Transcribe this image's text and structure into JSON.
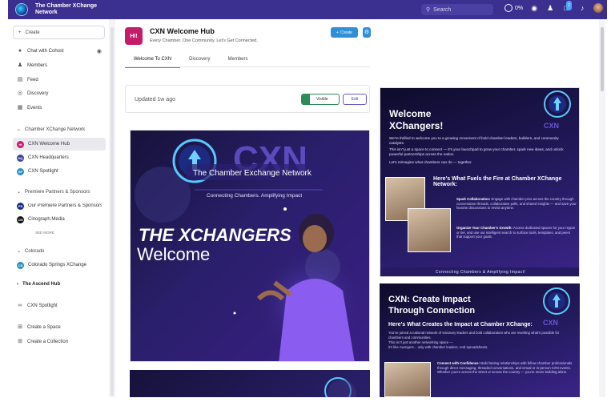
{
  "brand": {
    "line1": "The Chamber XChange",
    "line2": "Network"
  },
  "topbar": {
    "search_placeholder": "Search",
    "progress": "0%",
    "notif_badge": "2"
  },
  "sidebar": {
    "create_label": "Create",
    "items": [
      {
        "label": "Chat with Cohost",
        "icon": "chat-icon"
      },
      {
        "label": "Members",
        "icon": "members-icon"
      },
      {
        "label": "Feed",
        "icon": "feed-icon"
      },
      {
        "label": "Discovery",
        "icon": "compass-icon"
      },
      {
        "label": "Events",
        "icon": "calendar-icon"
      }
    ],
    "group1": "Chamber XChange Network",
    "group1_items": [
      {
        "label": "CXN Welcome Hub",
        "avatar": "HI",
        "color": "#c41b6b"
      },
      {
        "label": "CXN Headquarters",
        "avatar": "HQ",
        "color": "#3b3fa0"
      },
      {
        "label": "CXN Spotlight",
        "avatar": "SP",
        "color": "#2a90c0"
      }
    ],
    "group2": "Premiere Partners & Sponsors",
    "group2_items": [
      {
        "label": "Our Premiere Partners & Sponsors",
        "avatar": "PS",
        "color": "#1a2c8a"
      },
      {
        "label": "Cinograph.Media",
        "avatar": "CM",
        "color": "#111111"
      }
    ],
    "see_more": "SEE MORE",
    "group3": "Colorado",
    "group3_items": [
      {
        "label": "Colorado Springs XChange",
        "avatar": "CS",
        "color": "#2a90c0"
      }
    ],
    "group4": "The Ascend Hub",
    "footer_items": [
      {
        "label": "CXN Spotlight",
        "icon": "link-icon"
      },
      {
        "label": "Create a Space",
        "icon": "plus-box-icon"
      },
      {
        "label": "Create a Collection",
        "icon": "plus-box-icon"
      }
    ]
  },
  "hub": {
    "logo_text": "HI!",
    "title": "CXN Welcome Hub",
    "subtitle": "Every Chamber. One Community. Let's Get Connected.",
    "create_button": "Create",
    "tabs": [
      "Welcome To CXN",
      "Discovery",
      "Members"
    ]
  },
  "update_card": {
    "updated": "Updated 1w ago",
    "visible_label": "Visible",
    "edit_label": "Edit"
  },
  "poster": {
    "network_name": "The Chamber Exchange Network",
    "tagline": "Connecting Chambers. Amplifying Impact",
    "headline": "THE XCHANGERS",
    "welcome": "Welcome",
    "logo_text": "CXN"
  },
  "card1": {
    "title_l1": "Welcome",
    "title_l2": "XChangers!",
    "logo_text": "CXN",
    "para1": "We're thrilled to welcome you to a growing movement of bold chamber leaders, builders, and community catalysts.",
    "para2": "This isn't just a space to connect — it's your launchpad to grow your chamber, spark new ideas, and unlock powerful partnerships across the nation.",
    "para3": "Let's reimagine what chambers can do — together.",
    "section_title": "Here's What Fuels the Fire at Chamber XChange Network:",
    "bullet1_title": "Spark Collaboration:",
    "bullet1": "Engage with chamber pros across the country through conversation threads, collaborative polls, and shared insights — and save your favorite discussions to revisit anytime.",
    "bullet2_title": "Organize Your Chamber's Growth:",
    "bullet2": "Access dedicated spaces for your region or tier, and use our intelligent search to surface tools, templates, and peers that support your goals.",
    "banner": "Connecting Chambers & Amplifying Impact!"
  },
  "card2": {
    "title_l1": "CXN: Create Impact",
    "title_l2": "Through Connection",
    "logo_text": "CXN",
    "section_title": "Here's What Creates the Impact at Chamber XChange:",
    "para1": "You've joined a national network of visionary leaders and bold collaborators who are rewriting what's possible for chambers and communities.",
    "para2": "This isn't just another networking space —",
    "para3": "it's like Avengers... only with chamber leaders. And spreadsheets.",
    "bullet_title": "Connect with Confidence:",
    "bullet": "Build lasting relationships with fellow chamber professionals through direct messaging, threaded conversations, and virtual or in-person CXN events. Whether you're across the street or across the country — you're never building alone."
  }
}
